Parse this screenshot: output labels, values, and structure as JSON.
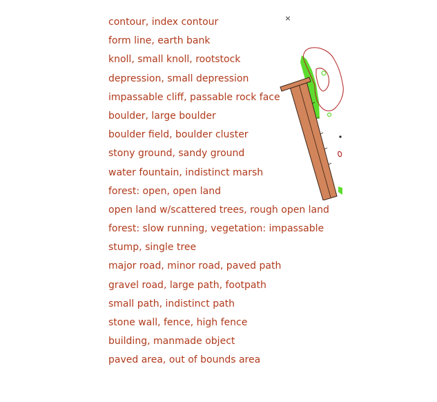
{
  "close_symbol": "×",
  "legend": {
    "items": [
      "contour, index contour",
      "form line, earth bank",
      "knoll, small knoll, rootstock",
      "depression, small depression",
      "impassable cliff, passable rock face",
      "boulder, large boulder",
      "boulder field, boulder cluster",
      "stony ground, sandy ground",
      "water fountain, indistinct marsh",
      "forest: open, open land",
      "open land w/scattered trees, rough open land",
      "forest: slow running, vegetation: impassable",
      "stump, single tree",
      "major road, minor road, paved path",
      "gravel road, large path, footpath",
      "small path, indistinct path",
      "stone wall, fence, high fence",
      "building, manmade object",
      "paved area, out of bounds area"
    ]
  },
  "colors": {
    "legend_text": "#b03a1c",
    "road_fill": "#d2845a",
    "road_edge": "#3a2418",
    "vegetation": "#5ddc2e",
    "contour": "#b22222"
  },
  "icons": {
    "close": "close-icon",
    "map": "map-preview-icon"
  }
}
